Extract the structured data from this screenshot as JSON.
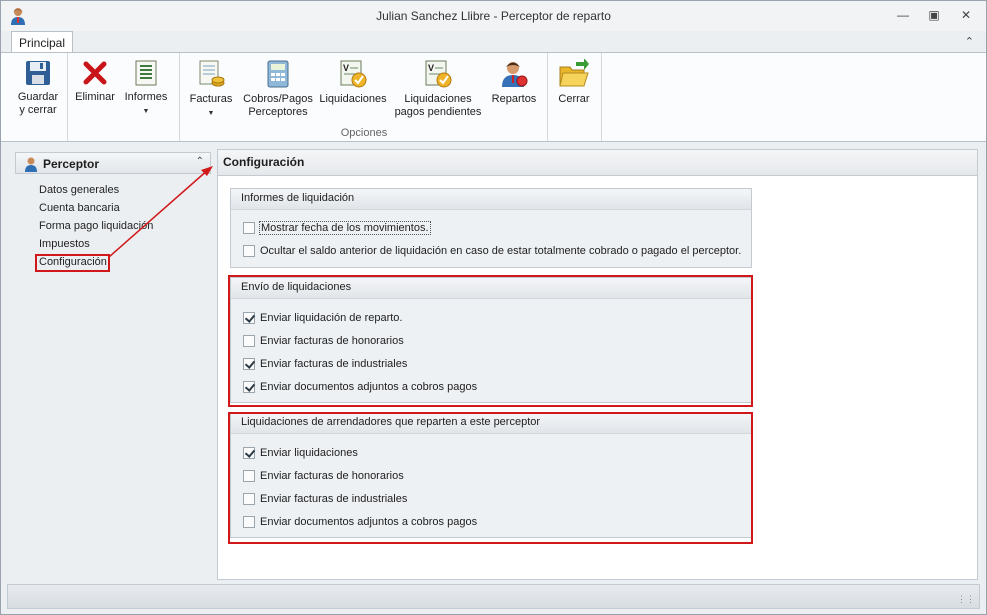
{
  "window": {
    "title": "Julian Sanchez Llibre - Perceptor de reparto"
  },
  "ribbon": {
    "tab": "Principal",
    "buttons": {
      "guardar_l1": "Guardar",
      "guardar_l2": "y cerrar",
      "eliminar": "Eliminar",
      "informes": "Informes",
      "facturas": "Facturas",
      "cobros_l1": "Cobros/Pagos",
      "cobros_l2": "Perceptores",
      "liquidaciones": "Liquidaciones",
      "liq_pend_l1": "Liquidaciones",
      "liq_pend_l2": "pagos pendientes",
      "repartos": "Repartos",
      "cerrar": "Cerrar"
    },
    "group_label": "Opciones"
  },
  "nav": {
    "title": "Perceptor",
    "items": [
      "Datos generales",
      "Cuenta bancaria",
      "Forma pago liquidación",
      "Impuestos",
      "Configuración"
    ],
    "selected": "Configuración"
  },
  "content": {
    "title": "Configuración",
    "groups": [
      {
        "title": "Informes de liquidación",
        "options": [
          {
            "label": "Mostrar fecha de los movimientos.",
            "checked": false
          },
          {
            "label": "Ocultar el saldo anterior de liquidación en caso de estar totalmente cobrado o pagado el perceptor.",
            "checked": false
          }
        ]
      },
      {
        "title": "Envío de liquidaciones",
        "options": [
          {
            "label": "Enviar liquidación de reparto.",
            "checked": true
          },
          {
            "label": "Enviar facturas de honorarios",
            "checked": false
          },
          {
            "label": "Enviar facturas de industriales",
            "checked": true
          },
          {
            "label": "Enviar documentos adjuntos a cobros pagos",
            "checked": true
          }
        ]
      },
      {
        "title": "Liquidaciones de arrendadores que reparten a este perceptor",
        "options": [
          {
            "label": "Enviar liquidaciones",
            "checked": true
          },
          {
            "label": "Enviar facturas de honorarios",
            "checked": false
          },
          {
            "label": "Enviar facturas de industriales",
            "checked": false
          },
          {
            "label": "Enviar documentos adjuntos a cobros pagos",
            "checked": false
          }
        ]
      }
    ]
  },
  "colors": {
    "highlight_red": "#d0181b"
  }
}
